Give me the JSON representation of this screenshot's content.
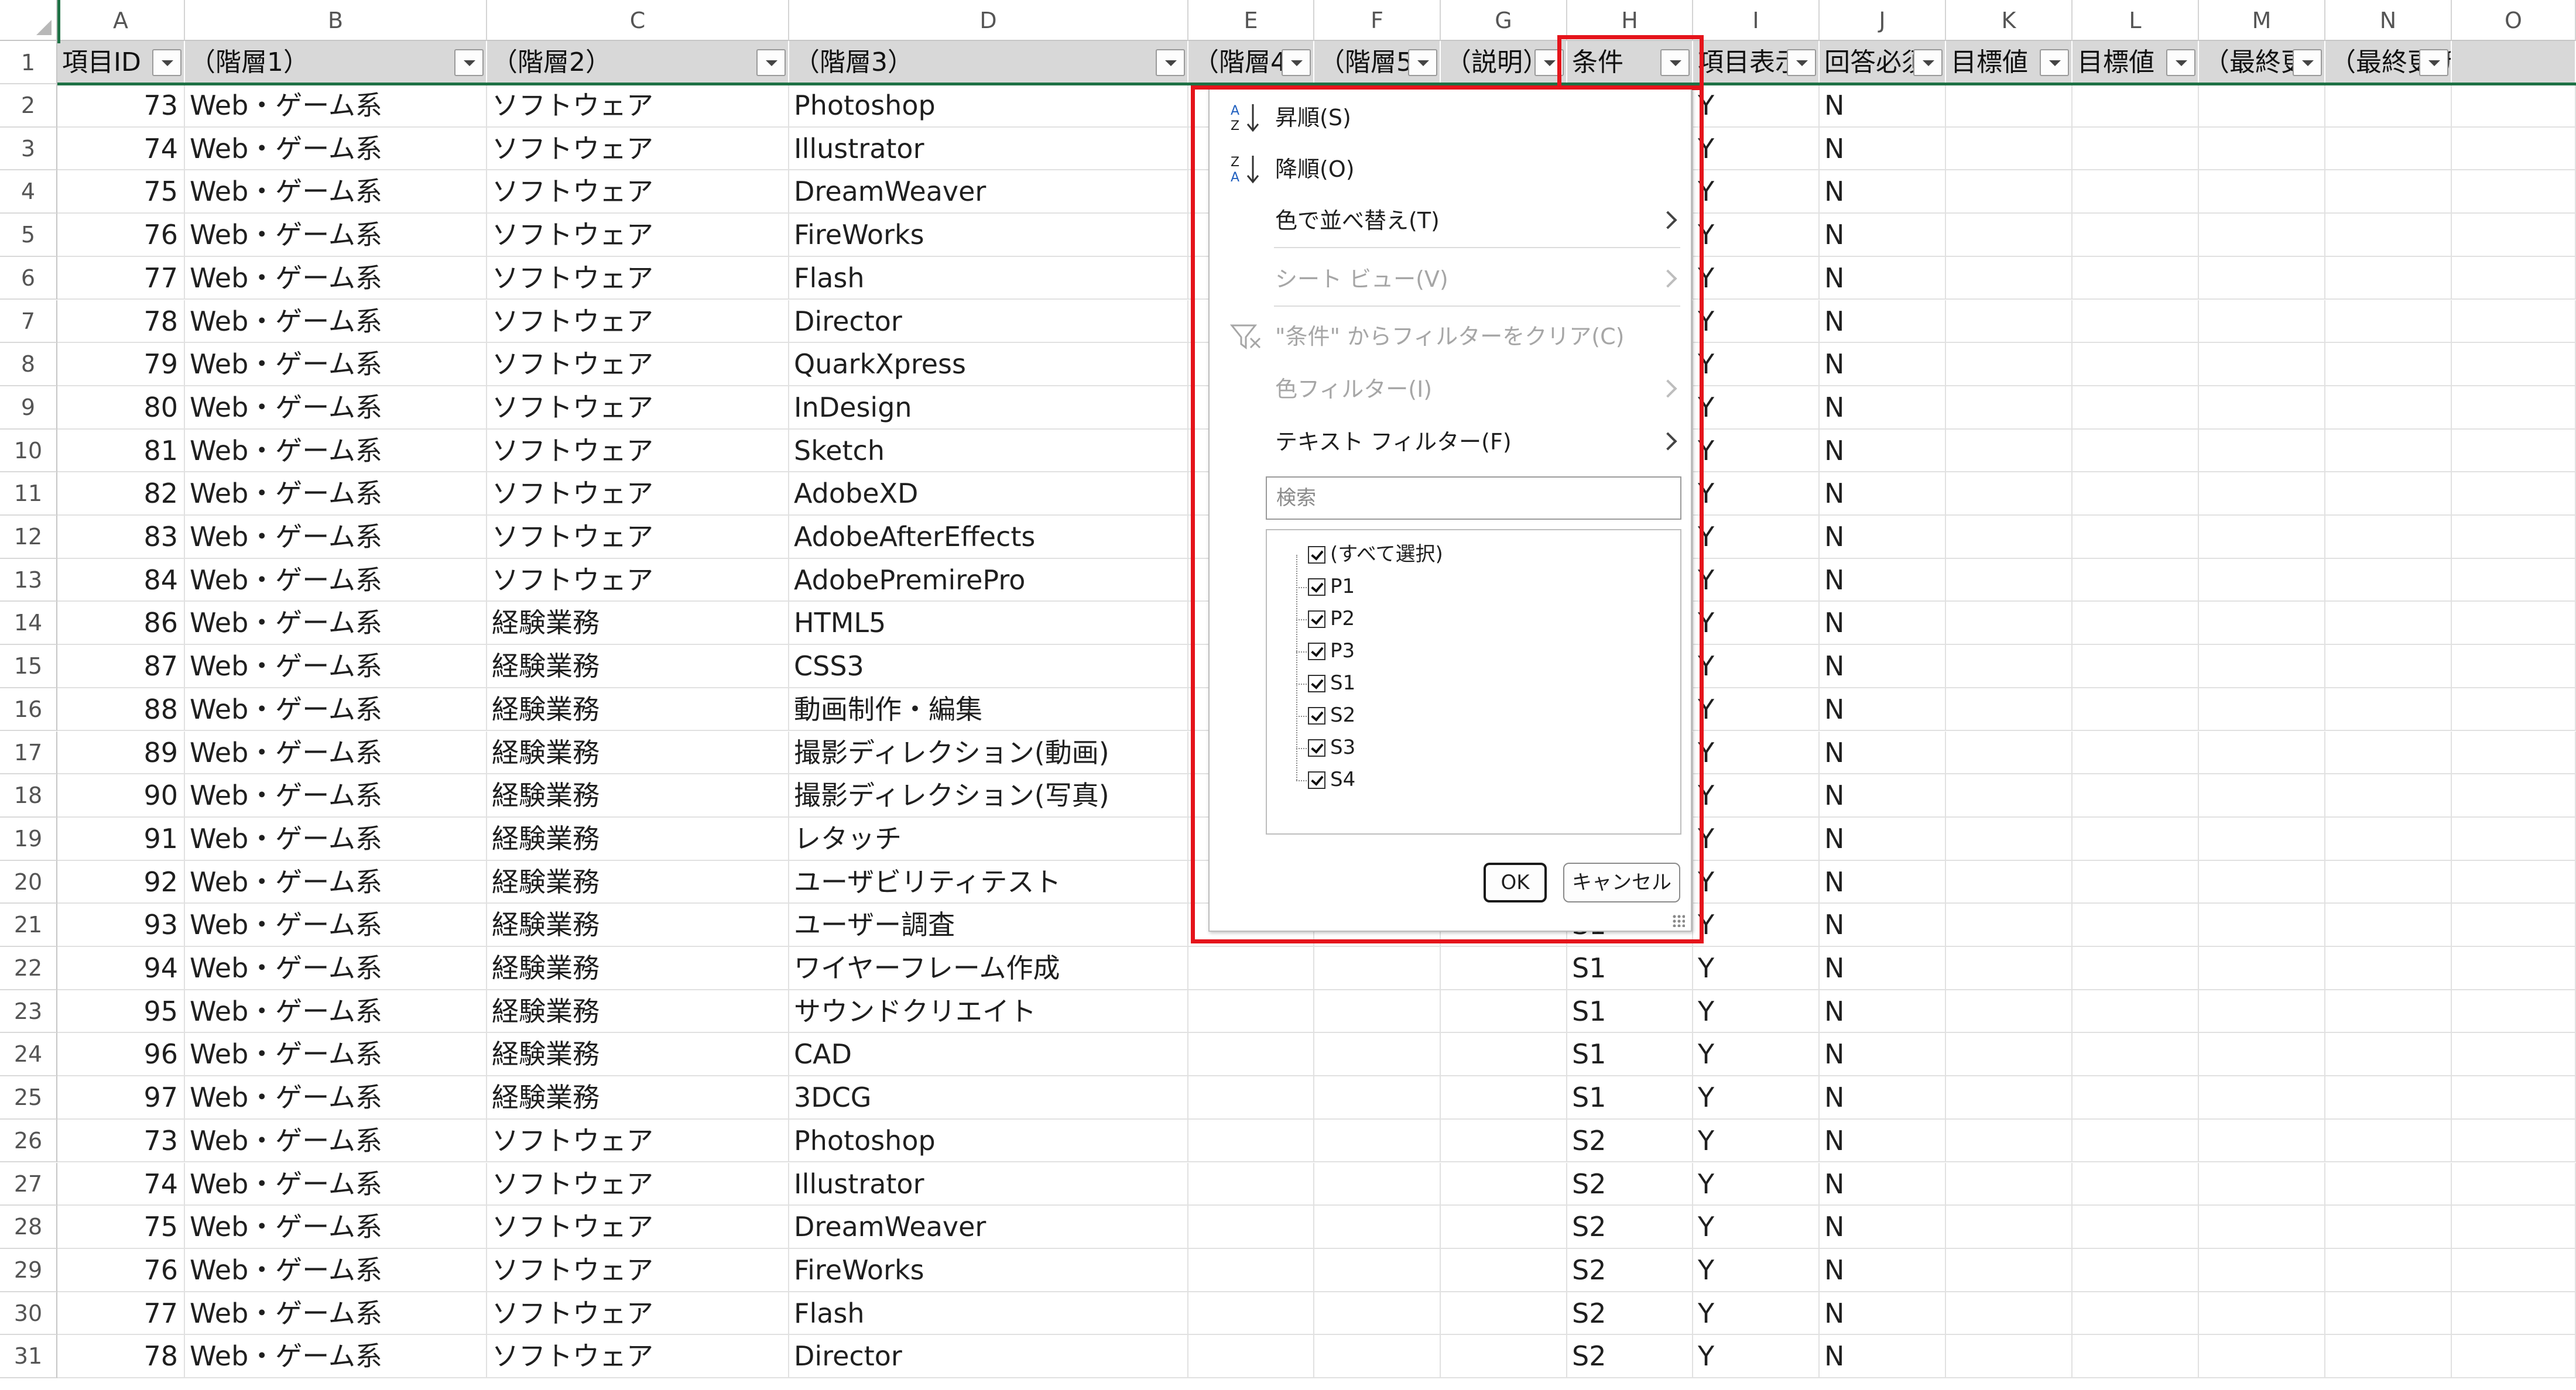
{
  "sheet": {
    "column_letters": [
      "A",
      "B",
      "C",
      "D",
      "E",
      "F",
      "G",
      "H",
      "I",
      "J",
      "K",
      "L",
      "M",
      "N",
      "O"
    ],
    "header_row_number": "1",
    "headers": [
      "項目ID",
      "（階層1）",
      "（階層2）",
      "（階層3）",
      "（階層4",
      "（階層5",
      "（説明）",
      "条件",
      "項目表示",
      "回答必須",
      "目標値",
      "目標値",
      "（最終更",
      "（最終更新日時）",
      ""
    ],
    "rows": [
      {
        "n": "2",
        "id": "73",
        "b": "Web・ゲーム系",
        "c": "ソフトウェア",
        "d": "Photoshop",
        "h": "",
        "i": "Y",
        "j": "N"
      },
      {
        "n": "3",
        "id": "74",
        "b": "Web・ゲーム系",
        "c": "ソフトウェア",
        "d": "Illustrator",
        "h": "",
        "i": "Y",
        "j": "N"
      },
      {
        "n": "4",
        "id": "75",
        "b": "Web・ゲーム系",
        "c": "ソフトウェア",
        "d": "DreamWeaver",
        "h": "",
        "i": "Y",
        "j": "N"
      },
      {
        "n": "5",
        "id": "76",
        "b": "Web・ゲーム系",
        "c": "ソフトウェア",
        "d": "FireWorks",
        "h": "",
        "i": "Y",
        "j": "N"
      },
      {
        "n": "6",
        "id": "77",
        "b": "Web・ゲーム系",
        "c": "ソフトウェア",
        "d": "Flash",
        "h": "",
        "i": "Y",
        "j": "N"
      },
      {
        "n": "7",
        "id": "78",
        "b": "Web・ゲーム系",
        "c": "ソフトウェア",
        "d": "Director",
        "h": "",
        "i": "Y",
        "j": "N"
      },
      {
        "n": "8",
        "id": "79",
        "b": "Web・ゲーム系",
        "c": "ソフトウェア",
        "d": "QuarkXpress",
        "h": "",
        "i": "Y",
        "j": "N"
      },
      {
        "n": "9",
        "id": "80",
        "b": "Web・ゲーム系",
        "c": "ソフトウェア",
        "d": "InDesign",
        "h": "",
        "i": "Y",
        "j": "N"
      },
      {
        "n": "10",
        "id": "81",
        "b": "Web・ゲーム系",
        "c": "ソフトウェア",
        "d": "Sketch",
        "h": "",
        "i": "Y",
        "j": "N"
      },
      {
        "n": "11",
        "id": "82",
        "b": "Web・ゲーム系",
        "c": "ソフトウェア",
        "d": "AdobeXD",
        "h": "",
        "i": "Y",
        "j": "N"
      },
      {
        "n": "12",
        "id": "83",
        "b": "Web・ゲーム系",
        "c": "ソフトウェア",
        "d": "AdobeAfterEffects",
        "h": "",
        "i": "Y",
        "j": "N"
      },
      {
        "n": "13",
        "id": "84",
        "b": "Web・ゲーム系",
        "c": "ソフトウェア",
        "d": "AdobePremirePro",
        "h": "",
        "i": "Y",
        "j": "N"
      },
      {
        "n": "14",
        "id": "86",
        "b": "Web・ゲーム系",
        "c": "経験業務",
        "d": "HTML5",
        "h": "",
        "i": "Y",
        "j": "N"
      },
      {
        "n": "15",
        "id": "87",
        "b": "Web・ゲーム系",
        "c": "経験業務",
        "d": "CSS3",
        "h": "",
        "i": "Y",
        "j": "N"
      },
      {
        "n": "16",
        "id": "88",
        "b": "Web・ゲーム系",
        "c": "経験業務",
        "d": "動画制作・編集",
        "h": "",
        "i": "Y",
        "j": "N"
      },
      {
        "n": "17",
        "id": "89",
        "b": "Web・ゲーム系",
        "c": "経験業務",
        "d": "撮影ディレクション(動画)",
        "h": "",
        "i": "Y",
        "j": "N"
      },
      {
        "n": "18",
        "id": "90",
        "b": "Web・ゲーム系",
        "c": "経験業務",
        "d": "撮影ディレクション(写真)",
        "h": "",
        "i": "Y",
        "j": "N"
      },
      {
        "n": "19",
        "id": "91",
        "b": "Web・ゲーム系",
        "c": "経験業務",
        "d": "レタッチ",
        "h": "",
        "i": "Y",
        "j": "N"
      },
      {
        "n": "20",
        "id": "92",
        "b": "Web・ゲーム系",
        "c": "経験業務",
        "d": "ユーザビリティテスト",
        "h": "",
        "i": "Y",
        "j": "N"
      },
      {
        "n": "21",
        "id": "93",
        "b": "Web・ゲーム系",
        "c": "経験業務",
        "d": "ユーザー調査",
        "h": "S1",
        "i": "Y",
        "j": "N"
      },
      {
        "n": "22",
        "id": "94",
        "b": "Web・ゲーム系",
        "c": "経験業務",
        "d": "ワイヤーフレーム作成",
        "h": "S1",
        "i": "Y",
        "j": "N"
      },
      {
        "n": "23",
        "id": "95",
        "b": "Web・ゲーム系",
        "c": "経験業務",
        "d": "サウンドクリエイト",
        "h": "S1",
        "i": "Y",
        "j": "N"
      },
      {
        "n": "24",
        "id": "96",
        "b": "Web・ゲーム系",
        "c": "経験業務",
        "d": "CAD",
        "h": "S1",
        "i": "Y",
        "j": "N"
      },
      {
        "n": "25",
        "id": "97",
        "b": "Web・ゲーム系",
        "c": "経験業務",
        "d": "3DCG",
        "h": "S1",
        "i": "Y",
        "j": "N"
      },
      {
        "n": "26",
        "id": "73",
        "b": "Web・ゲーム系",
        "c": "ソフトウェア",
        "d": "Photoshop",
        "h": "S2",
        "i": "Y",
        "j": "N"
      },
      {
        "n": "27",
        "id": "74",
        "b": "Web・ゲーム系",
        "c": "ソフトウェア",
        "d": "Illustrator",
        "h": "S2",
        "i": "Y",
        "j": "N"
      },
      {
        "n": "28",
        "id": "75",
        "b": "Web・ゲーム系",
        "c": "ソフトウェア",
        "d": "DreamWeaver",
        "h": "S2",
        "i": "Y",
        "j": "N"
      },
      {
        "n": "29",
        "id": "76",
        "b": "Web・ゲーム系",
        "c": "ソフトウェア",
        "d": "FireWorks",
        "h": "S2",
        "i": "Y",
        "j": "N"
      },
      {
        "n": "30",
        "id": "77",
        "b": "Web・ゲーム系",
        "c": "ソフトウェア",
        "d": "Flash",
        "h": "S2",
        "i": "Y",
        "j": "N"
      },
      {
        "n": "31",
        "id": "78",
        "b": "Web・ゲーム系",
        "c": "ソフトウェア",
        "d": "Director",
        "h": "S2",
        "i": "Y",
        "j": "N"
      }
    ]
  },
  "dropdown": {
    "sort_asc": "昇順(S)",
    "sort_desc": "降順(O)",
    "sort_by_color": "色で並べ替え(T)",
    "sheet_view": "シート ビュー(V)",
    "clear_filter": "\"条件\" からフィルターをクリア(C)",
    "color_filter": "色フィルター(I)",
    "text_filter": "テキスト フィルター(F)",
    "search_placeholder": "検索",
    "checklist": [
      "(すべて選択)",
      "P1",
      "P2",
      "P3",
      "S1",
      "S2",
      "S3",
      "S4"
    ],
    "ok": "OK",
    "cancel": "キャンセル"
  },
  "colors": {
    "highlight": "#e5141b",
    "frozen_line": "#1e7145",
    "header_fill": "#d8d8d8"
  }
}
